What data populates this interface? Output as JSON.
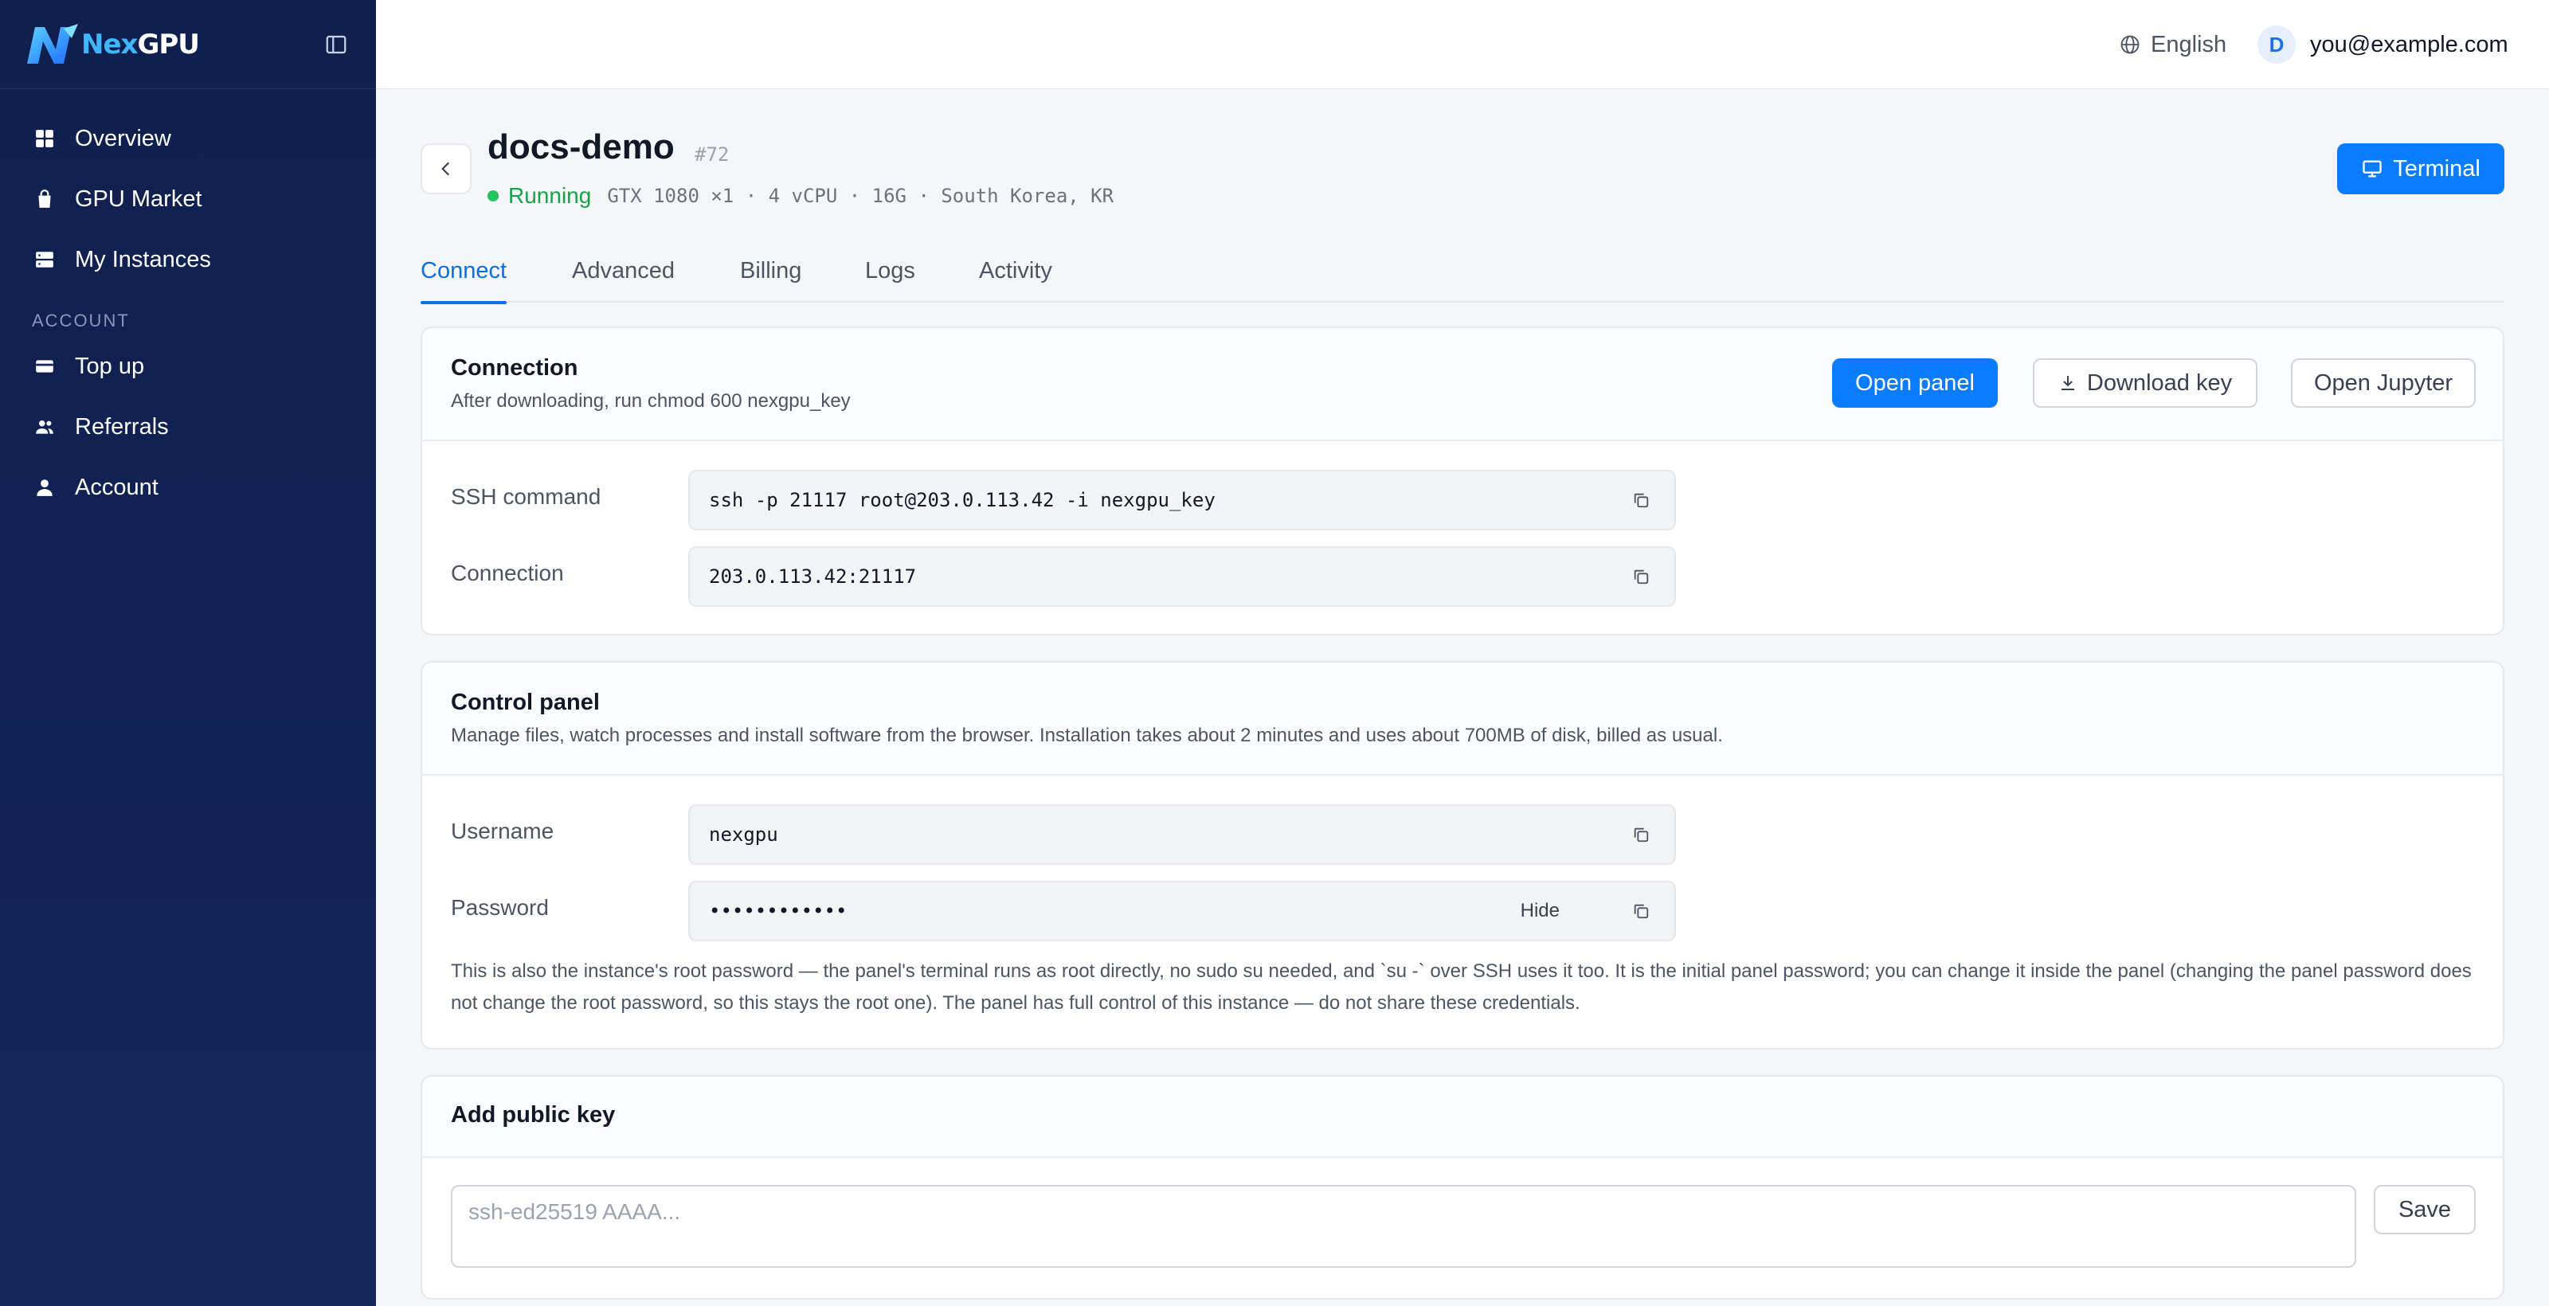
{
  "brand": {
    "name_part1": "Nex",
    "name_part2": "GPU"
  },
  "sidebar": {
    "items": [
      {
        "label": "Overview",
        "icon": "grid-icon"
      },
      {
        "label": "GPU Market",
        "icon": "bag-icon"
      },
      {
        "label": "My Instances",
        "icon": "server-icon"
      }
    ],
    "section_account": "ACCOUNT",
    "account_items": [
      {
        "label": "Top up",
        "icon": "card-icon"
      },
      {
        "label": "Referrals",
        "icon": "users-icon"
      },
      {
        "label": "Account",
        "icon": "user-icon"
      }
    ]
  },
  "topbar": {
    "language": "English",
    "avatar_initial": "D",
    "email": "you@example.com"
  },
  "instance": {
    "name": "docs-demo",
    "id": "#72",
    "status": "Running",
    "specs": "GTX 1080 ×1 · 4 vCPU · 16G · South Korea, KR"
  },
  "header": {
    "terminal_label": "Terminal"
  },
  "tabs": [
    {
      "label": "Connect",
      "active": true
    },
    {
      "label": "Advanced"
    },
    {
      "label": "Billing"
    },
    {
      "label": "Logs"
    },
    {
      "label": "Activity"
    }
  ],
  "connection": {
    "title": "Connection",
    "subtitle": "After downloading, run chmod 600 nexgpu_key",
    "open_panel": "Open panel",
    "download_key": "Download key",
    "open_jupyter": "Open Jupyter",
    "ssh_label": "SSH command",
    "ssh_value": "ssh -p 21117 root@203.0.113.42 -i nexgpu_key",
    "conn_label": "Connection",
    "conn_value": "203.0.113.42:21117"
  },
  "control_panel": {
    "title": "Control panel",
    "subtitle": "Manage files, watch processes and install software from the browser. Installation takes about 2 minutes and uses about 700MB of disk, billed as usual.",
    "username_label": "Username",
    "username_value": "nexgpu",
    "password_label": "Password",
    "password_value": "••••••••••••",
    "hide_label": "Hide",
    "note": "This is also the instance's root password — the panel's terminal runs as root directly, no sudo su needed, and `su -` over SSH uses it too. It is the initial panel password; you can change it inside the panel (changing the panel password does not change the root password, so this stays the root one). The panel has full control of this instance — do not share these credentials."
  },
  "public_key": {
    "title": "Add public key",
    "placeholder": "ssh-ed25519 AAAA...",
    "save_label": "Save"
  },
  "colors": {
    "sidebar": "#102252",
    "primary": "#0a7cff",
    "success": "#16a34a"
  }
}
